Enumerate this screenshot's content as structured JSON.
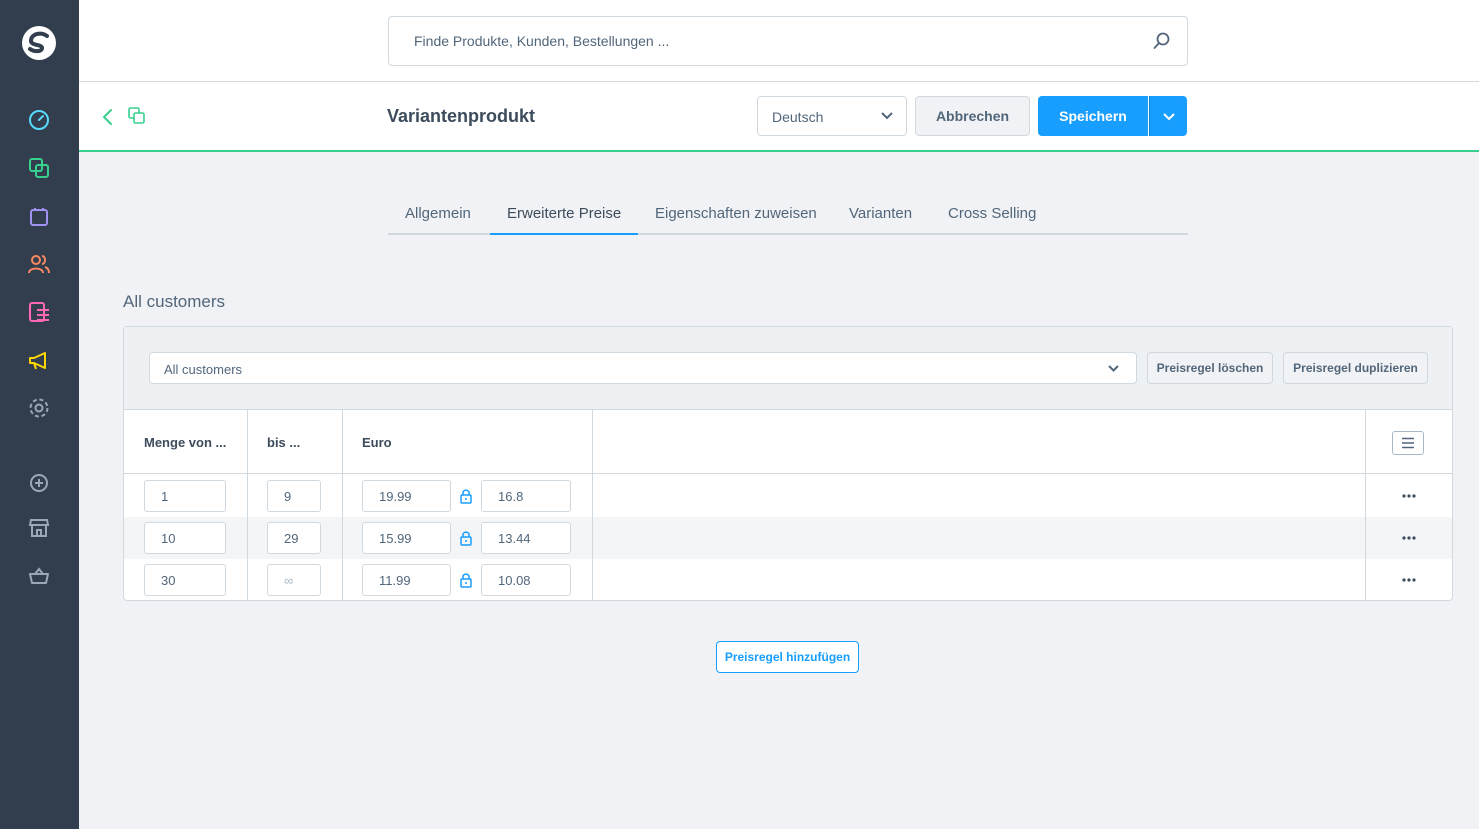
{
  "search": {
    "placeholder": "Finde Produkte, Kunden, Bestellungen ..."
  },
  "sidebar": {
    "items": [
      {
        "name": "dashboard-icon",
        "color": "#57d9fb"
      },
      {
        "name": "catalogue-icon",
        "color": "#37d08e"
      },
      {
        "name": "orders-icon",
        "color": "#a092f0"
      },
      {
        "name": "customers-icon",
        "color": "#f88962"
      },
      {
        "name": "content-icon",
        "color": "#ff68b4"
      },
      {
        "name": "marketing-icon",
        "color": "#ffd700"
      },
      {
        "name": "settings-icon",
        "color": "#9aa8b5"
      },
      {
        "name": "plus-circle-icon",
        "color": "#9aa8b5"
      },
      {
        "name": "storefront-icon",
        "color": "#9aa8b5"
      },
      {
        "name": "basket-icon",
        "color": "#9aa8b5"
      }
    ]
  },
  "smartbar": {
    "title": "Variantenprodukt",
    "language": "Deutsch",
    "cancel_label": "Abbrechen",
    "save_label": "Speichern"
  },
  "tabs": [
    {
      "label": "Allgemein",
      "active": false
    },
    {
      "label": "Erweiterte Preise",
      "active": true
    },
    {
      "label": "Eigenschaften zuweisen",
      "active": false
    },
    {
      "label": "Varianten",
      "active": false
    },
    {
      "label": "Cross Selling",
      "active": false
    }
  ],
  "price_rule": {
    "title": "All customers",
    "selected_rule": "All customers",
    "delete_label": "Preisregel löschen",
    "duplicate_label": "Preisregel duplizieren",
    "columns": [
      "Menge von ...",
      "bis ...",
      "Euro"
    ],
    "rows": [
      {
        "from": "1",
        "to": "9",
        "gross": "19.99",
        "net": "16.8"
      },
      {
        "from": "10",
        "to": "29",
        "gross": "15.99",
        "net": "13.44"
      },
      {
        "from": "30",
        "to": "∞",
        "gross": "11.99",
        "net": "10.08"
      }
    ]
  },
  "add_rule_label": "Preisregel hinzufügen",
  "colors": {
    "accent": "#189eff",
    "sidebar": "#323d4d",
    "catalogue_green": "#37d08e"
  }
}
